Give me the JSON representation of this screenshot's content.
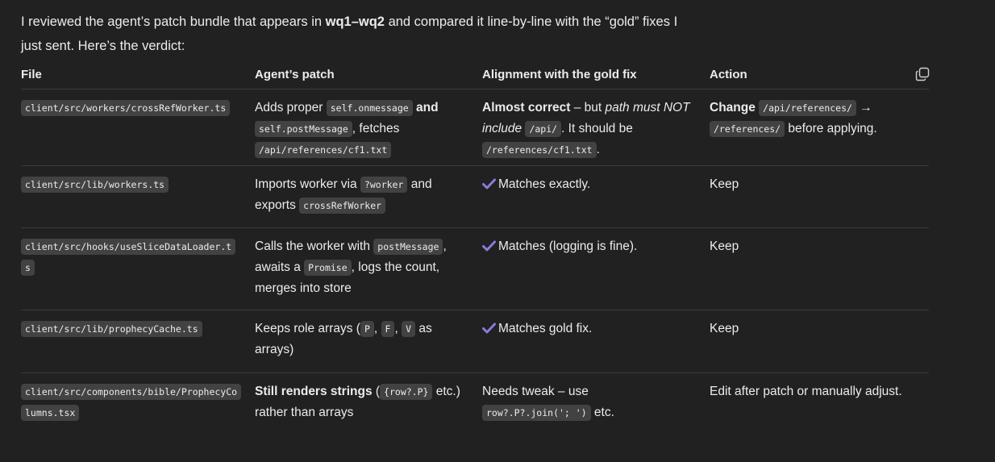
{
  "intro": {
    "pre": "I reviewed the agent’s patch bundle that appears in ",
    "bold": "wq1–wq2",
    "post": " and compared it line-by-line with the “gold” fixes I just sent. Here’s the verdict:"
  },
  "table": {
    "headers": [
      "File",
      "Agent’s patch",
      "Alignment with the gold fix",
      "Action"
    ],
    "copy_icon": "copy-icon",
    "rows": [
      {
        "file": "client/src/workers/crossRefWorker.ts",
        "patch": {
          "t1": "Adds proper ",
          "c1": "self.onmessage",
          "b1": " and",
          "c2": "self.postMessage",
          "t2": ", fetches",
          "c3": "/api/references/cf1.txt"
        },
        "align": {
          "b1": "Almost correct",
          "t1": " – but ",
          "i1": "path must NOT include",
          "c1": "/api/",
          "t2": ". It should be",
          "c2": "/references/cf1.txt",
          "t3": "."
        },
        "action": {
          "b1": "Change",
          "c1": "/api/references/",
          "t1": " →",
          "c2": "/references/",
          "t2": " before applying."
        }
      },
      {
        "file": "client/src/lib/workers.ts",
        "patch": {
          "t1": "Imports worker via ",
          "c1": "?worker",
          "t2": " and exports ",
          "c2": "crossRefWorker"
        },
        "align": {
          "t1": "Matches exactly."
        },
        "action": {
          "t1": "Keep"
        }
      },
      {
        "file": "client/src/hooks/useSliceDataLoader.ts",
        "patch": {
          "t1": "Calls the worker with ",
          "c1": "postMessage",
          "t2": ", awaits a ",
          "c2": "Promise",
          "t3": ", logs the count, merges into store"
        },
        "align": {
          "t1": "Matches (logging is fine)."
        },
        "action": {
          "t1": "Keep"
        }
      },
      {
        "file": "client/src/lib/prophecyCache.ts",
        "patch": {
          "t1": "Keeps role arrays (",
          "c1": "P",
          "c2": "F",
          "c3": "V",
          "t2": " as arrays)"
        },
        "align": {
          "t1": "Matches gold fix."
        },
        "action": {
          "t1": "Keep"
        }
      },
      {
        "file": "client/src/components/bible/ProphecyColumns.tsx",
        "patch": {
          "b1": "Still renders strings",
          "t1": " (",
          "c1": "{row?.P}",
          "t2": " etc.) rather than arrays"
        },
        "align": {
          "t1": "Needs tweak – use",
          "c1": "row?.P?.join('; ')",
          "t2": " etc."
        },
        "action": {
          "t1": "Edit after patch or manually adjust."
        }
      }
    ]
  },
  "colors": {
    "background": "#212121",
    "text": "#ececec",
    "code_bg": "#424242",
    "check": "#8b7bd8",
    "divider": "#3a3a3a"
  }
}
